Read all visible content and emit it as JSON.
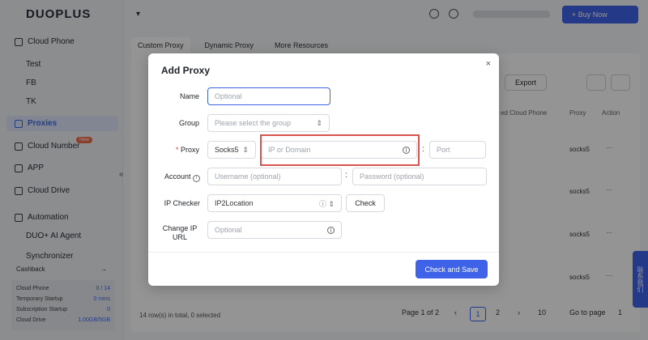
{
  "app": {
    "logo": "DUOPLUS"
  },
  "sidebar": {
    "cloud_phone": "Cloud Phone",
    "groups": [
      "Test",
      "FB",
      "TK"
    ],
    "proxies": "Proxies",
    "cloud_number": "Cloud Number",
    "new_badge": "New",
    "app": "APP",
    "cloud_drive": "Cloud Drive",
    "automation": "Automation",
    "ai_agent": "DUO+ AI Agent",
    "synchronizer": "Synchronizer",
    "cashback": "Cashback",
    "stats": [
      {
        "label": "Cloud Phone",
        "value": "0 / 14"
      },
      {
        "label": "Temporary Startup",
        "value": "0 mins"
      },
      {
        "label": "Subscription Startup",
        "value": "0"
      },
      {
        "label": "Cloud Drive",
        "value": "1.00GB/5GB"
      }
    ]
  },
  "header": {
    "buy_now": "+ Buy Now"
  },
  "tabs": [
    "Custom Proxy",
    "Dynamic Proxy",
    "More Resources"
  ],
  "toolbar": {
    "export": "Export"
  },
  "table": {
    "col_cloud_phone": "ed Cloud Phone",
    "col_proxy": "Proxy",
    "col_action": "Action",
    "rows": [
      {
        "proxy": "socks5",
        "action": "···"
      },
      {
        "proxy": "socks5",
        "action": "···"
      },
      {
        "proxy": "socks5",
        "action": "···"
      },
      {
        "proxy": "socks5",
        "action": "···"
      }
    ]
  },
  "pagination": {
    "total": "14 row(s) in total, 0 selected",
    "page_info": "Page 1 of 2",
    "pages": [
      "1",
      "2"
    ],
    "page_size": "10",
    "goto": "Go to page",
    "goto_value": "1"
  },
  "side_button": "联系我们",
  "modal": {
    "title": "Add Proxy",
    "close": "×",
    "name_label": "Name",
    "name_placeholder": "Optional",
    "group_label": "Group",
    "group_placeholder": "Please select the group",
    "proxy_required": "*",
    "proxy_label": "Proxy",
    "proxy_type": "Socks5",
    "host_placeholder": "IP or Domain",
    "port_placeholder": "Port",
    "account_label": "Account",
    "username_placeholder": "Username (optional)",
    "password_placeholder": "Password (optional)",
    "ip_checker_label": "IP Checker",
    "ip_checker_value": "IP2Location",
    "check_button": "Check",
    "change_ip_label": "Change IP URL",
    "change_ip_placeholder": "Optional",
    "save_button": "Check and Save"
  },
  "colors": {
    "accent": "#3f63e8",
    "highlight": "#d9534f",
    "required": "#e03e3e"
  }
}
